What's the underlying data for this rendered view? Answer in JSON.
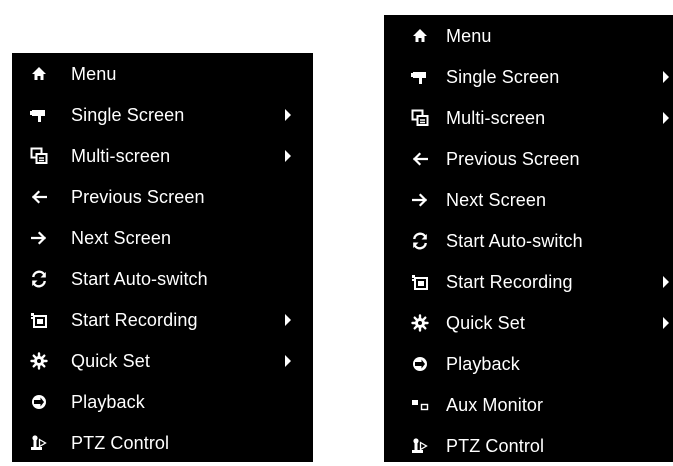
{
  "menus": [
    {
      "items": [
        {
          "label": "Menu",
          "icon": "home-icon",
          "has_submenu": false
        },
        {
          "label": "Single Screen",
          "icon": "camera-icon",
          "has_submenu": true
        },
        {
          "label": "Multi-screen",
          "icon": "multi-screen-icon",
          "has_submenu": true
        },
        {
          "label": "Previous Screen",
          "icon": "arrow-left-icon",
          "has_submenu": false
        },
        {
          "label": "Next Screen",
          "icon": "arrow-right-icon",
          "has_submenu": false
        },
        {
          "label": "Start Auto-switch",
          "icon": "refresh-icon",
          "has_submenu": false
        },
        {
          "label": "Start Recording",
          "icon": "record-icon",
          "has_submenu": true
        },
        {
          "label": "Quick Set",
          "icon": "gear-icon",
          "has_submenu": true
        },
        {
          "label": "Playback",
          "icon": "playback-icon",
          "has_submenu": false
        },
        {
          "label": "PTZ Control",
          "icon": "ptz-icon",
          "has_submenu": false
        }
      ]
    },
    {
      "items": [
        {
          "label": "Menu",
          "icon": "home-icon",
          "has_submenu": false
        },
        {
          "label": "Single Screen",
          "icon": "camera-icon",
          "has_submenu": true
        },
        {
          "label": "Multi-screen",
          "icon": "multi-screen-icon",
          "has_submenu": true
        },
        {
          "label": "Previous Screen",
          "icon": "arrow-left-icon",
          "has_submenu": false
        },
        {
          "label": "Next Screen",
          "icon": "arrow-right-icon",
          "has_submenu": false
        },
        {
          "label": "Start Auto-switch",
          "icon": "refresh-icon",
          "has_submenu": false
        },
        {
          "label": "Start Recording",
          "icon": "record-icon",
          "has_submenu": true
        },
        {
          "label": "Quick Set",
          "icon": "gear-icon",
          "has_submenu": true
        },
        {
          "label": "Playback",
          "icon": "playback-icon",
          "has_submenu": false
        },
        {
          "label": "Aux Monitor",
          "icon": "aux-monitor-icon",
          "has_submenu": false
        },
        {
          "label": "PTZ Control",
          "icon": "ptz-icon",
          "has_submenu": false
        }
      ]
    }
  ],
  "colors": {
    "menu_background": "#000000",
    "menu_text": "#ffffff",
    "page_background": "#ffffff"
  }
}
